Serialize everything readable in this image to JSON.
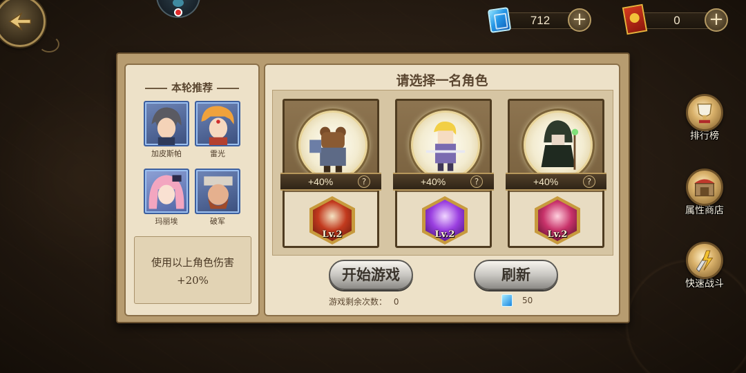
{
  "currency": {
    "gems": {
      "icon": "blue-gem-icon",
      "value": "712",
      "plus": "+"
    },
    "cards": {
      "icon": "red-card-icon",
      "value": "0",
      "plus": "+"
    }
  },
  "recommend": {
    "title": "本轮推荐",
    "heroes": [
      {
        "name": "加皮斯帕"
      },
      {
        "name": "雷光"
      },
      {
        "name": "玛丽埃"
      },
      {
        "name": "破军"
      }
    ],
    "bonus_line1": "使用以上角色伤害",
    "bonus_line2": "+20%"
  },
  "select": {
    "title": "请选择一名角色",
    "cards": [
      {
        "bonus": "+40%",
        "help": "?",
        "level": "Lv.2"
      },
      {
        "bonus": "+40%",
        "help": "?",
        "level": "Lv.2"
      },
      {
        "bonus": "+40%",
        "help": "?",
        "level": "Lv.2"
      }
    ],
    "start_label": "开始游戏",
    "refresh_label": "刷新",
    "remaining_label": "游戏剩余次数：",
    "remaining_value": "0",
    "refresh_cost": "50"
  },
  "side_menu": [
    {
      "label": "排行榜",
      "icon": "trophy-icon"
    },
    {
      "label": "属性商店",
      "icon": "shop-icon"
    },
    {
      "label": "快速战斗",
      "icon": "quick-battle-icon"
    }
  ],
  "colors": {
    "panel_frame": "#b79c70",
    "parchment": "#ede1c8",
    "text_brown": "#5a4630",
    "hero_border": "#3d5f9e"
  }
}
